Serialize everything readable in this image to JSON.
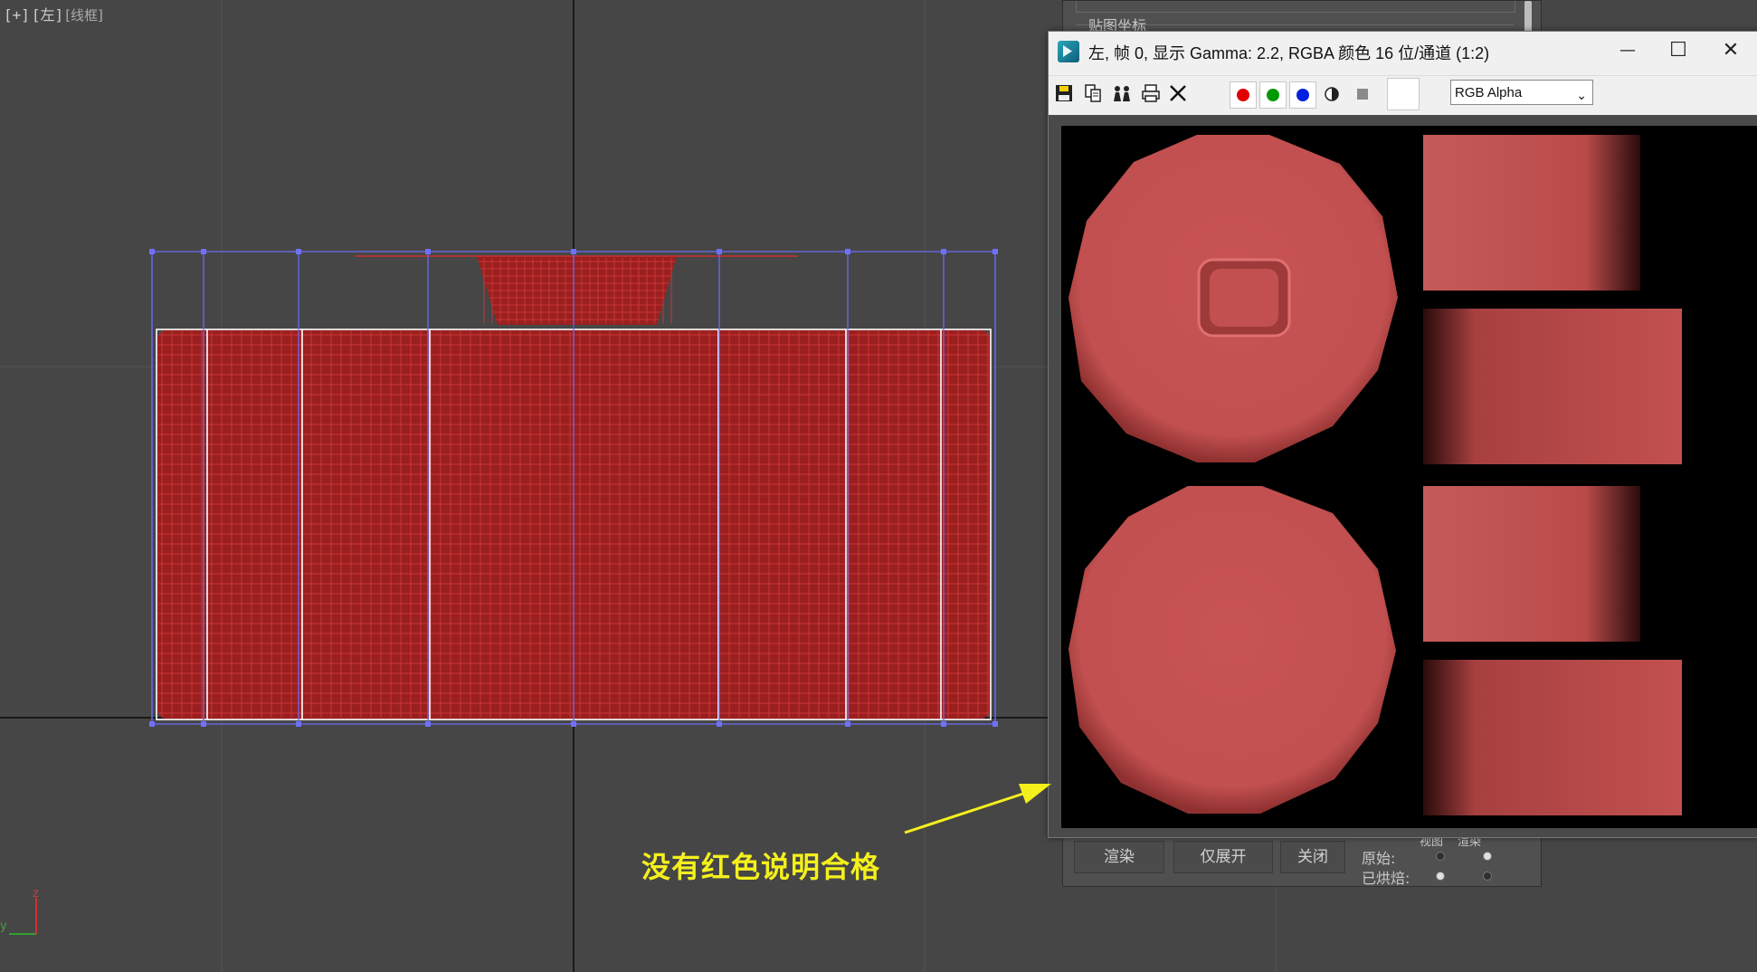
{
  "viewport": {
    "label_plus": "[+]",
    "label_view": "[左]",
    "label_mode": "[线框]",
    "axis_z": "z",
    "axis_y": "y"
  },
  "bake_dialog": {
    "group_title": "贴图坐标",
    "render_button": "渲染",
    "unwrap_only_button": "仅展开",
    "close_button": "关闭",
    "col_viewport": "视图",
    "col_render": "渲染",
    "row_original": "原始:",
    "row_baked": "已烘焙:"
  },
  "frame_buffer": {
    "title": "左, 帧 0, 显示 Gamma: 2.2, RGBA 颜色 16 位/通道 (1:2)",
    "minimize": "—",
    "maximize": "☐",
    "close": "✕",
    "channel_display": "RGB Alpha",
    "toolbar_icons": [
      "save-icon",
      "copy-icon",
      "clone-icon",
      "print-icon",
      "clear-icon"
    ],
    "channels": [
      {
        "name": "red-channel",
        "color": "#e00000"
      },
      {
        "name": "green-channel",
        "color": "#009a00"
      },
      {
        "name": "blue-channel",
        "color": "#0020e0"
      }
    ],
    "texture_color": "#c25050"
  },
  "annotation": {
    "text": "没有红色说明合格",
    "color": "#f4f01c"
  }
}
